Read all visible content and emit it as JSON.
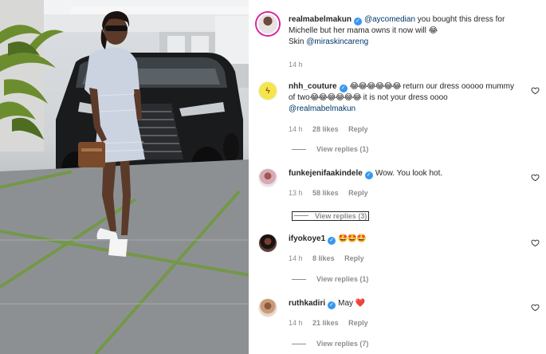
{
  "caption": {
    "username": "realmabelmakun",
    "mention": "@aycomedian",
    "text": " you bought this dress for Michelle but her mama owns it now will 😂",
    "skin_prefix": "Skin ",
    "skin_mention": "@miraskincareng",
    "time": "14 h"
  },
  "comments": [
    {
      "username": "nhh_couture",
      "emoji_a": "😂😂😂😂😂😂",
      "text_a": " return our dress ooooo mummy of two",
      "emoji_b": "😂😂😂😂😂😂",
      "text_b": " it is not your dress oooo ",
      "mention": "@realmabelmakun",
      "time": "14 h",
      "likes": "28 likes",
      "reply": "Reply",
      "view_replies": "View replies (1)"
    },
    {
      "username": "funkejenifaakindele",
      "text": "Wow. You look hot.",
      "time": "13 h",
      "likes": "58 likes",
      "reply": "Reply",
      "view_replies": "View replies (3)"
    },
    {
      "username": "ifyokoye1",
      "text": "🤩🤩🤩",
      "time": "14 h",
      "likes": "8 likes",
      "reply": "Reply",
      "view_replies": "View replies (1)"
    },
    {
      "username": "ruthkadiri",
      "text": "May ❤️",
      "time": "14 h",
      "likes": "21 likes",
      "reply": "Reply",
      "view_replies": "View replies (7)"
    }
  ],
  "colors": {
    "verified": "#3897f0",
    "mention": "#00376b",
    "meta": "#8e8e8e",
    "heart_red": "#ed4956"
  }
}
